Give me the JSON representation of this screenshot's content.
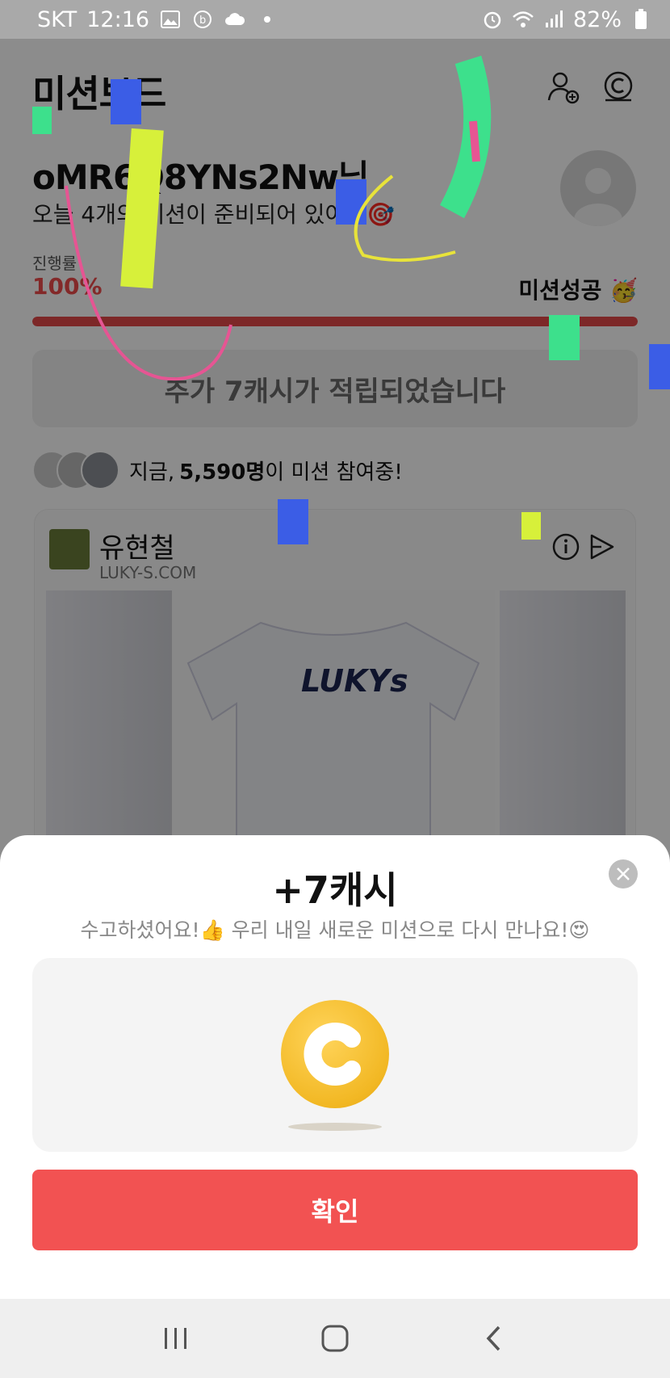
{
  "status_bar": {
    "carrier": "SKT",
    "time": "12:16",
    "battery": "82%",
    "icons": [
      "image-icon",
      "b-app-icon",
      "cloud-icon",
      "dot-icon",
      "alarm-icon",
      "wifi-icon",
      "signal-icon",
      "battery-icon"
    ]
  },
  "header": {
    "title": "미션보드",
    "icons": [
      "add-friend-icon",
      "cash-icon"
    ]
  },
  "greeting": {
    "name": "oMR6Q8YNs2Nw님",
    "subtitle": "오늘 4개의 미션이 준비되어 있어요🎯"
  },
  "progress": {
    "label": "진행률",
    "value": "100%",
    "fraction": 1.0,
    "done_label": "미션성공 🥳"
  },
  "banner": {
    "text": "추가 7캐시가 적립되었습니다"
  },
  "participants": {
    "prefix": "지금,",
    "count": "5,590명",
    "suffix": "이 미션 참여중!"
  },
  "card": {
    "name": "유현철",
    "url": "LUKY-S.COM",
    "shirt_text": "LUKYs",
    "icons": [
      "info-icon",
      "share-icon"
    ]
  },
  "sheet": {
    "title": "+7캐시",
    "subtitle": "수고하셨어요!👍 우리 내일 새로운 미션으로 다시 만나요!😍",
    "close_icon": "close-icon",
    "coin_icon": "coin-icon",
    "confirm_label": "확인"
  },
  "navbar": {
    "icons": [
      "recent-apps-icon",
      "home-icon",
      "back-icon"
    ]
  },
  "colors": {
    "accent": "#f25252",
    "progress": "#e44a4a",
    "coin": "#f2b824"
  }
}
